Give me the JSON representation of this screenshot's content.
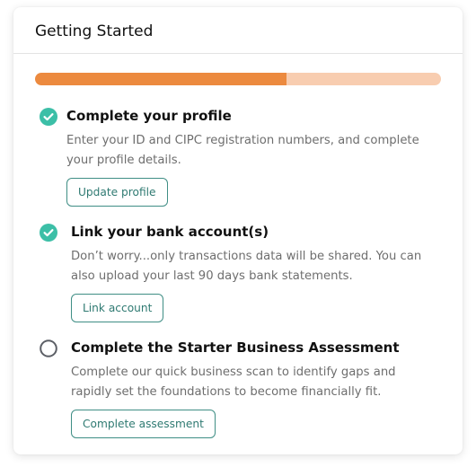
{
  "card": {
    "title": "Getting Started",
    "progress_fraction": 0.62,
    "colors": {
      "progress_fill": "#ec8a3f",
      "progress_track": "#f8cdb0",
      "check": "#3cbfa7",
      "button_border": "#3f8e85"
    }
  },
  "steps": [
    {
      "title": "Complete your profile",
      "description": "Enter your ID and CIPC registration numbers, and complete your profile details.",
      "button_label": "Update profile",
      "status": "complete",
      "icon": "check-circle-icon"
    },
    {
      "title": "Link your bank account(s)",
      "description": "Don’t worry...only transactions data will be shared. You can also upload your last 90 days bank statements.",
      "button_label": "Link account",
      "status": "complete",
      "icon": "check-circle-icon"
    },
    {
      "title": "Complete the Starter Business Assessment",
      "description": "Complete our quick business scan to identify gaps and rapidly set the foundations to become financially fit.",
      "button_label": "Complete assessment",
      "status": "incomplete",
      "icon": "empty-circle-icon"
    }
  ]
}
